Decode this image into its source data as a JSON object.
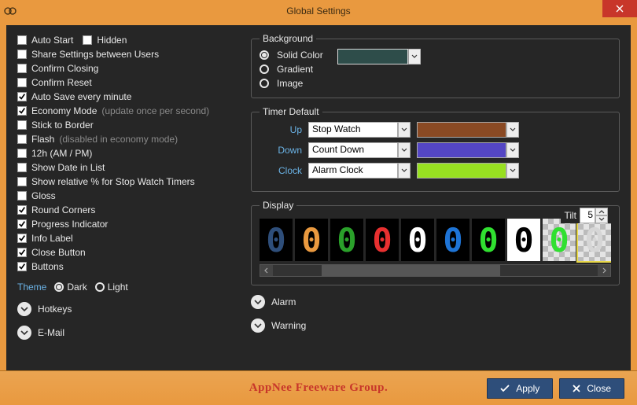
{
  "title": "Global Settings",
  "left": {
    "auto_start": "Auto Start",
    "hidden": "Hidden",
    "share_settings": "Share Settings between Users",
    "confirm_closing": "Confirm Closing",
    "confirm_reset": "Confirm Reset",
    "auto_save": "Auto Save every minute",
    "economy_mode": "Economy Mode",
    "economy_note": "(update once per second)",
    "stick_border": "Stick to Border",
    "flash": "Flash",
    "flash_note": "(disabled in economy mode)",
    "twelve_hour": "12h (AM / PM)",
    "show_date": "Show Date in List",
    "show_relative": "Show relative % for Stop Watch Timers",
    "gloss": "Gloss",
    "round_corners": "Round Corners",
    "progress_indicator": "Progress Indicator",
    "info_label": "Info Label",
    "close_button": "Close Button",
    "buttons": "Buttons"
  },
  "theme": {
    "label": "Theme",
    "dark": "Dark",
    "light": "Light"
  },
  "expanders": {
    "hotkeys": "Hotkeys",
    "email": "E-Mail",
    "alarm": "Alarm",
    "warning": "Warning"
  },
  "background": {
    "legend": "Background",
    "solid": "Solid Color",
    "gradient": "Gradient",
    "image": "Image",
    "color": "#2e4d4a"
  },
  "timer": {
    "legend": "Timer Default",
    "rows": [
      {
        "label": "Up",
        "value": "Stop Watch",
        "color": "#8a4a24"
      },
      {
        "label": "Down",
        "value": "Count Down",
        "color": "#5446c4"
      },
      {
        "label": "Clock",
        "value": "Alarm Clock",
        "color": "#98e021"
      }
    ]
  },
  "display": {
    "legend": "Display",
    "tilt_label": "Tilt",
    "tilt_value": "5",
    "digits": [
      {
        "bg": "black",
        "fg": "#2e4e7a"
      },
      {
        "bg": "black",
        "fg": "#e9993f"
      },
      {
        "bg": "black",
        "fg": "#2aa02a"
      },
      {
        "bg": "black",
        "fg": "#e83030"
      },
      {
        "bg": "black",
        "fg": "#ffffff"
      },
      {
        "bg": "black",
        "fg": "#1e74d6"
      },
      {
        "bg": "black",
        "fg": "#30e030"
      },
      {
        "bg": "white",
        "fg": "#000000"
      },
      {
        "bg": "checker",
        "fg": "#30e030"
      },
      {
        "bg": "checker",
        "fg": "#d6d6d6",
        "selected": true
      }
    ]
  },
  "footer": {
    "brand": "AppNee Freeware Group.",
    "apply": "Apply",
    "close": "Close"
  }
}
